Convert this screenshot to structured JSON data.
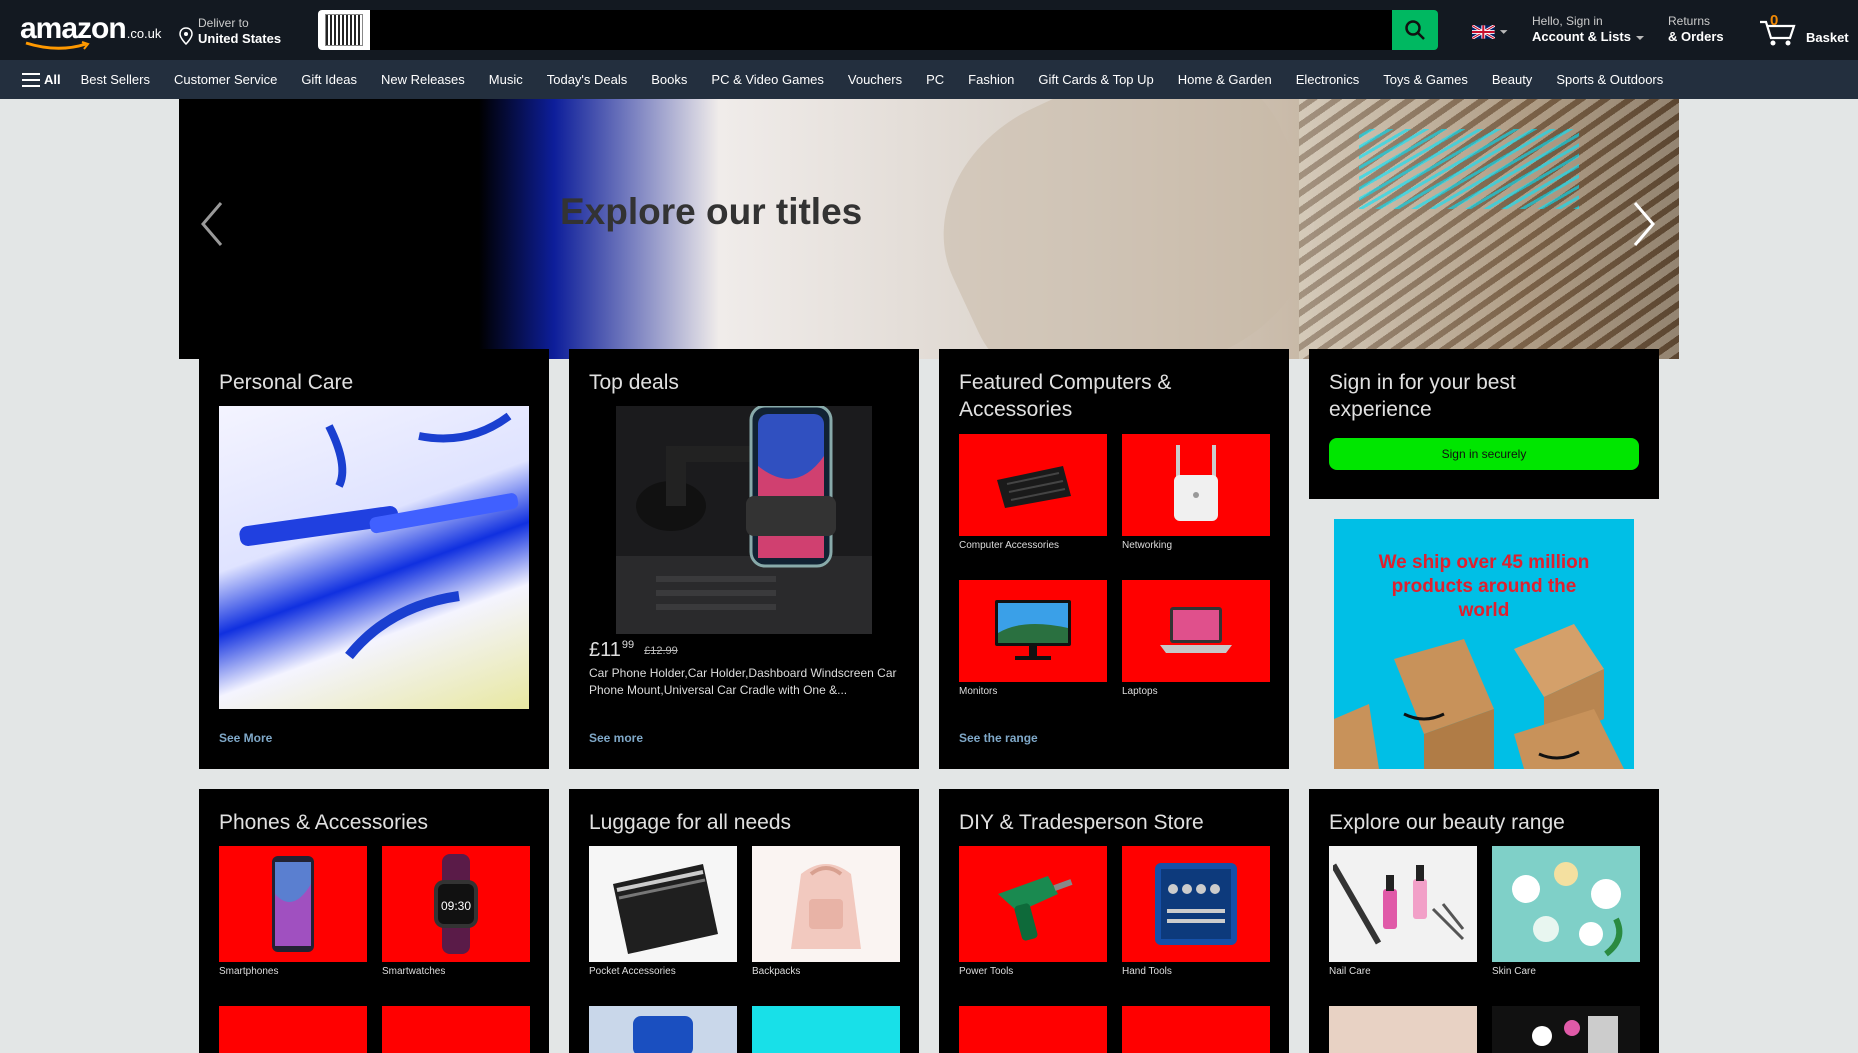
{
  "header": {
    "logo_word": "amazon",
    "logo_tld": ".co.uk",
    "deliver_label": "Deliver to",
    "deliver_location": "United States",
    "search_placeholder": "",
    "account_greeting": "Hello, Sign in",
    "account_label": "Account & Lists",
    "returns_label": "Returns",
    "orders_label": "& Orders",
    "basket_count": "0",
    "basket_label": "Basket"
  },
  "subnav": {
    "all_label": "All",
    "links": [
      "Best Sellers",
      "Customer Service",
      "Gift Ideas",
      "New Releases",
      "Music",
      "Today's Deals",
      "Books",
      "PC & Video Games",
      "Vouchers",
      "PC",
      "Fashion",
      "Gift Cards & Top Up",
      "Home & Garden",
      "Electronics",
      "Toys & Games",
      "Beauty",
      "Sports & Outdoors"
    ]
  },
  "hero": {
    "title": "Explore our titles"
  },
  "cards": {
    "personal_care": {
      "title": "Personal Care",
      "link": "See More"
    },
    "top_deals": {
      "title": "Top deals",
      "price": "£11",
      "price_cents": "99",
      "was_price": "£12.99",
      "product_name": "Car Phone Holder,Car Holder,Dashboard Windscreen Car Phone Mount,Universal Car Cradle with One &...",
      "link": "See more"
    },
    "computers": {
      "title": "Featured Computers & Accessories",
      "tiles": [
        "Computer Accessories",
        "Networking",
        "Monitors",
        "Laptops"
      ],
      "link": "See the range"
    },
    "signin": {
      "title": "Sign in for your best experience",
      "button": "Sign in securely"
    },
    "promo": {
      "text": "We ship over 45 million products around the world"
    },
    "phones": {
      "title": "Phones & Accessories",
      "tiles": [
        "Smartphones",
        "Smartwatches"
      ]
    },
    "luggage": {
      "title": "Luggage for all needs",
      "tiles": [
        "Pocket Accessories",
        "Backpacks"
      ]
    },
    "diy": {
      "title": "DIY & Tradesperson Store",
      "tiles": [
        "Power Tools",
        "Hand Tools"
      ]
    },
    "beauty": {
      "title": "Explore our beauty range",
      "tiles": [
        "Nail Care",
        "Skin Care"
      ]
    }
  },
  "colors": {
    "nav_bg": "#131921",
    "subnav_bg": "#232f3e",
    "search_button": "#00b861",
    "signin_button": "#00e600",
    "tile_bg": "#ff0000",
    "promo_bg": "#00bfe6",
    "promo_text": "#e0202e"
  }
}
